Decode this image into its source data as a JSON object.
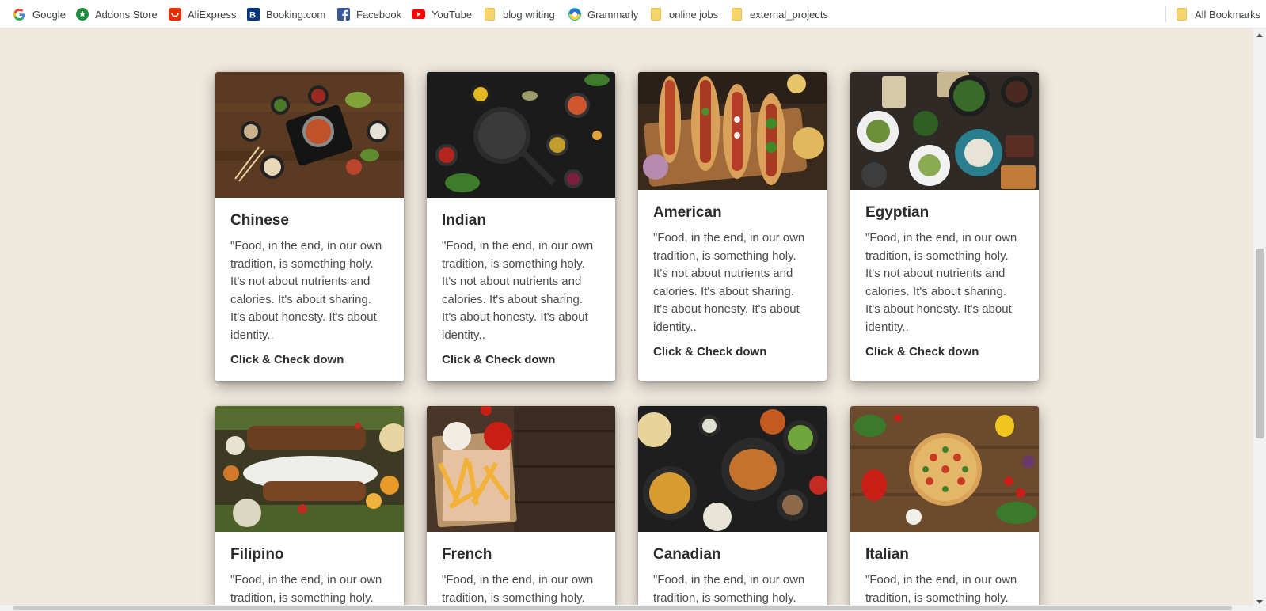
{
  "bookmarks": {
    "items": [
      {
        "label": "Google",
        "icon": "google-icon"
      },
      {
        "label": "Addons Store",
        "icon": "addons-store-icon"
      },
      {
        "label": "AliExpress",
        "icon": "aliexpress-icon"
      },
      {
        "label": "Booking.com",
        "icon": "booking-icon"
      },
      {
        "label": "Facebook",
        "icon": "facebook-icon"
      },
      {
        "label": "YouTube",
        "icon": "youtube-icon"
      },
      {
        "label": "blog writing",
        "icon": "folder-icon"
      },
      {
        "label": "Grammarly",
        "icon": "grammarly-icon"
      },
      {
        "label": "online jobs",
        "icon": "folder-icon"
      },
      {
        "label": "external_projects",
        "icon": "folder-icon"
      }
    ],
    "all_bookmarks": "All Bookmarks"
  },
  "cards": [
    {
      "title": "Chinese",
      "description": "\"Food, in the end, in our own tradition, is something holy. It's not about nutrients and calories. It's about sharing. It's about honesty. It's about identity..",
      "link": "Click & Check down"
    },
    {
      "title": "Indian",
      "description": "\"Food, in the end, in our own tradition, is something holy. It's not about nutrients and calories. It's about sharing. It's about honesty. It's about identity..",
      "link": "Click & Check down"
    },
    {
      "title": "American",
      "description": "\"Food, in the end, in our own tradition, is something holy. It's not about nutrients and calories. It's about sharing. It's about honesty. It's about identity..",
      "link": "Click & Check down"
    },
    {
      "title": "Egyptian",
      "description": "\"Food, in the end, in our own tradition, is something holy. It's not about nutrients and calories. It's about sharing. It's about honesty. It's about identity..",
      "link": "Click & Check down"
    },
    {
      "title": "Filipino",
      "description": "\"Food, in the end, in our own tradition, is something holy.",
      "link": ""
    },
    {
      "title": "French",
      "description": "\"Food, in the end, in our own tradition, is something holy.",
      "link": ""
    },
    {
      "title": "Canadian",
      "description": "\"Food, in the end, in our own tradition, is something holy.",
      "link": ""
    },
    {
      "title": "Italian",
      "description": "\"Food, in the end, in our own tradition, is something holy.",
      "link": ""
    }
  ],
  "colors": {
    "page_background": "#efe8dd",
    "card_background": "#ffffff",
    "title_text": "#2b2b2b",
    "body_text": "#4b4b4b"
  }
}
